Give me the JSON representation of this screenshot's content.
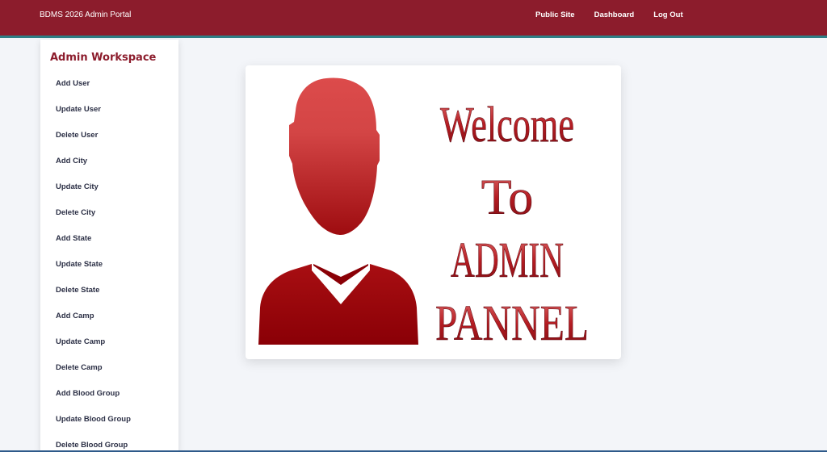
{
  "header": {
    "brand": "BDMS 2026 Admin Portal",
    "nav": [
      "Public Site",
      "Dashboard",
      "Log Out"
    ]
  },
  "sidebar": {
    "title": "Admin Workspace",
    "items": [
      "Add User",
      "Update User",
      "Delete User",
      "Add City",
      "Update City",
      "Delete City",
      "Add State",
      "Update State",
      "Delete State",
      "Add Camp",
      "Update Camp",
      "Delete Camp",
      "Add Blood Group",
      "Update Blood Group",
      "Delete Blood Group"
    ]
  },
  "banner": {
    "lines": [
      "Welcome",
      "To",
      "ADMIN",
      "PANNEL"
    ],
    "icon": "user-silhouette-icon"
  },
  "colors": {
    "header_bg": "#8c1c2c",
    "header_border": "#2e7f86",
    "accent": "#8c1c2c",
    "page_bg": "#f3f5f9"
  }
}
